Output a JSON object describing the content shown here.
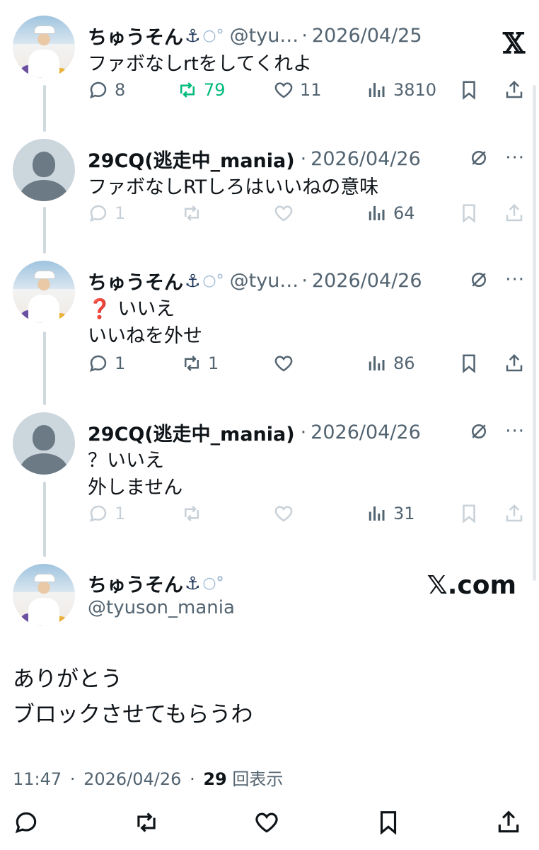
{
  "tweets": [
    {
      "name": "ちゅうそん",
      "emoji": "⚓",
      "bubble": "○°",
      "handle": "@tyu…",
      "date": "2026/04/25",
      "text": [
        "ファボなしrtをしてくれよ"
      ],
      "reply_count": "8",
      "retweet_count": "79",
      "like_count": "11",
      "view_count": "3810"
    },
    {
      "name": "29CQ(逃走中_mania)",
      "date": "2026/04/26",
      "text": [
        "ファボなしRTしろはいいねの意味"
      ],
      "reply_count": "1",
      "view_count": "64"
    },
    {
      "name": "ちゅうそん",
      "emoji": "⚓",
      "bubble": "○°",
      "handle": "@tyu…",
      "date": "2026/04/26",
      "text": [
        "❓ いいえ",
        "いいねを外せ"
      ],
      "reply_count": "1",
      "retweet_count": "1",
      "view_count": "86"
    },
    {
      "name": "29CQ(逃走中_mania)",
      "date": "2026/04/26",
      "text": [
        "？いいえ",
        "外しません"
      ],
      "reply_count": "1",
      "view_count": "31"
    }
  ],
  "main_tweet": {
    "name": "ちゅうそん",
    "emoji": "⚓",
    "bubble": "○°",
    "handle": "@tyuson_mania",
    "text": [
      "ありがとう",
      "ブロックさせてもらうわ"
    ],
    "time": "11:47",
    "date": "2026/04/26",
    "views": "29",
    "views_label": "回表示"
  },
  "brand": {
    "x_logo": "𝕏",
    "site": "𝕏.com"
  },
  "separator": "·",
  "colors": {
    "retweet_green": "#00ba7c",
    "muted": "#536471",
    "thread_line": "#cfd9de"
  }
}
